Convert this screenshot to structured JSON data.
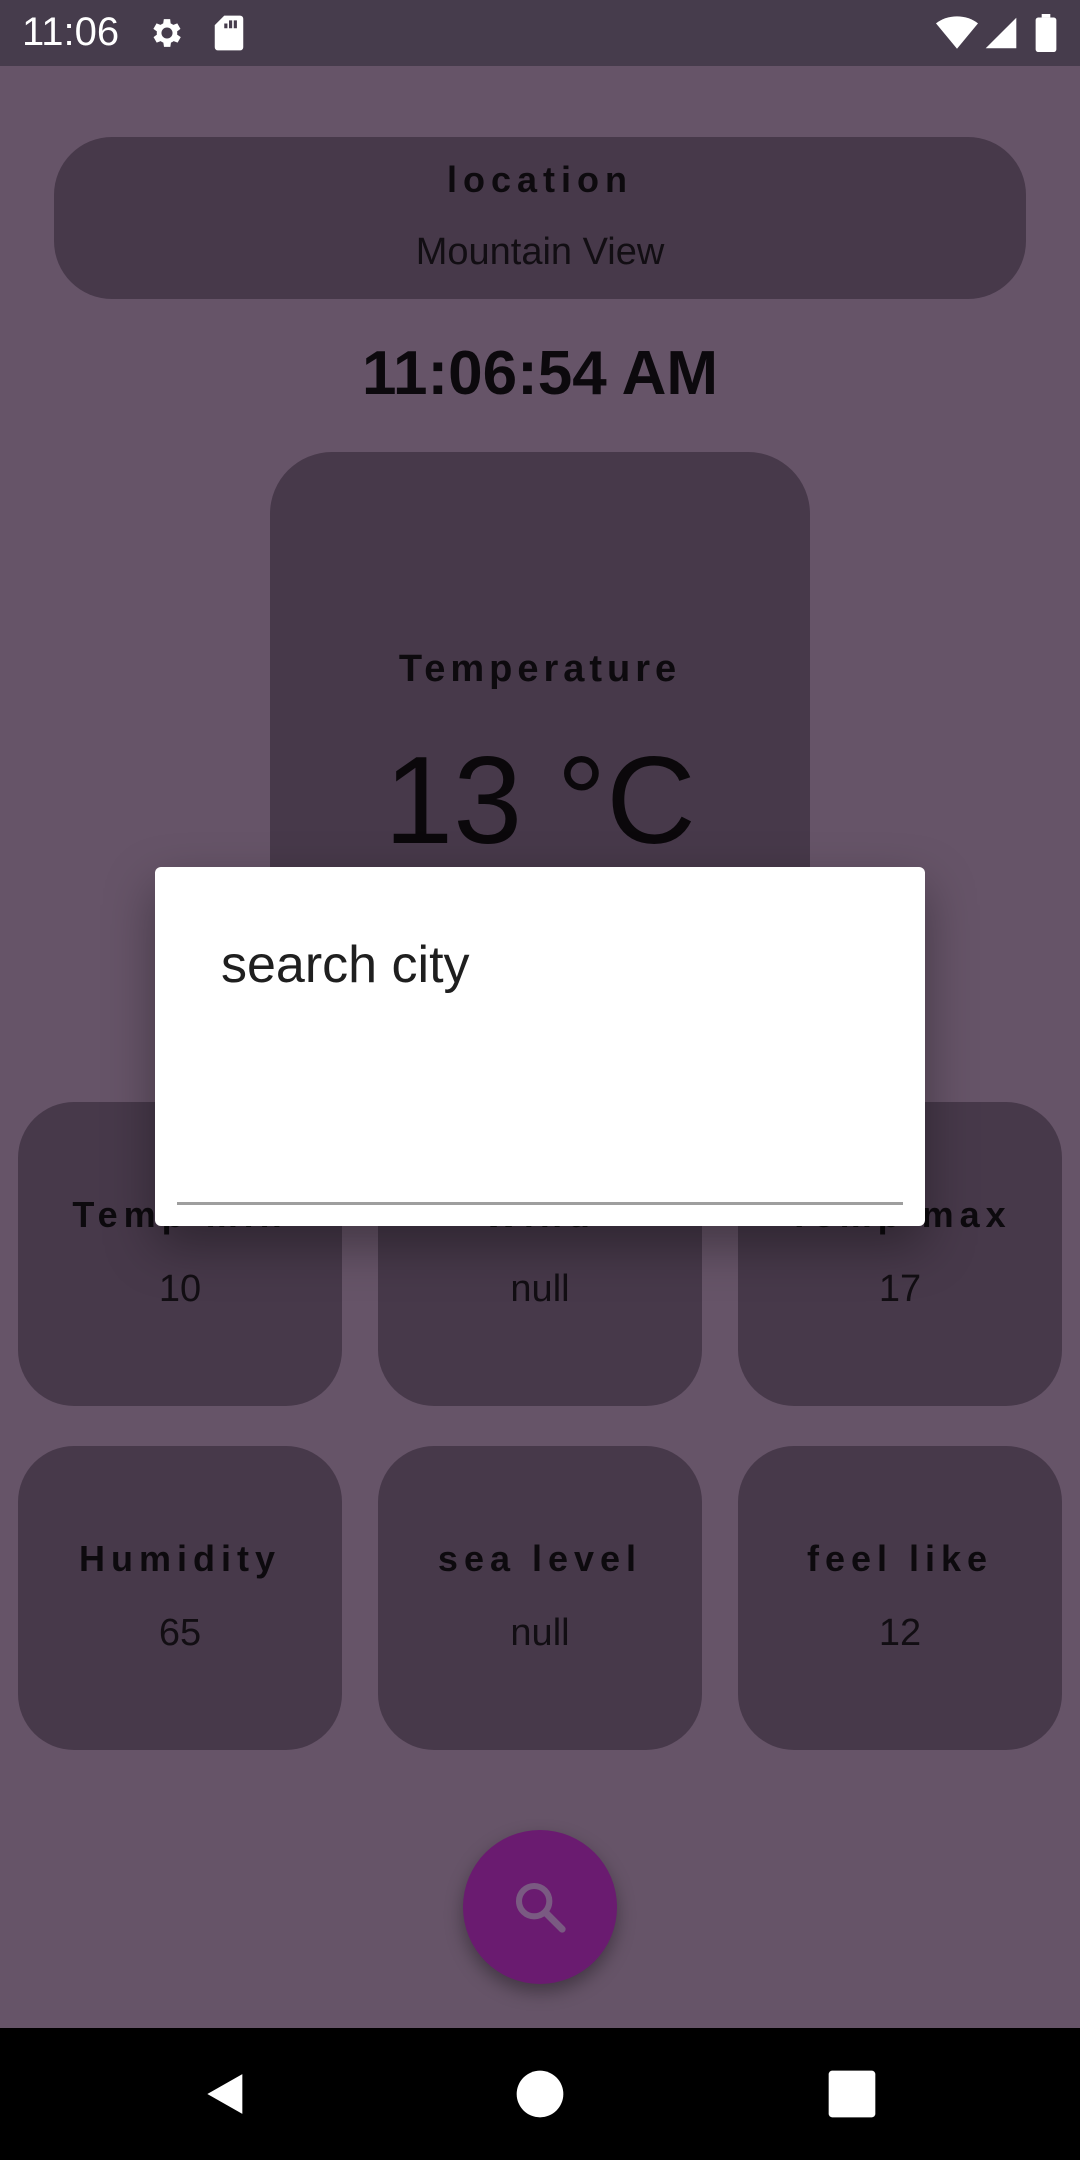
{
  "status_bar": {
    "time": "11:06",
    "icons": [
      "settings-icon",
      "sd-card-icon",
      "wifi-icon",
      "signal-icon",
      "battery-icon"
    ]
  },
  "location": {
    "label": "location",
    "value": "Mountain View"
  },
  "clock": "11:06:54 AM",
  "temperature": {
    "label": "Temperature",
    "value": "13 °C"
  },
  "stats": [
    {
      "label": "Temp min",
      "value": "10"
    },
    {
      "label": "Wind",
      "value": "null"
    },
    {
      "label": "Temp max",
      "value": "17"
    },
    {
      "label": "Humidity",
      "value": "65"
    },
    {
      "label": "sea level",
      "value": "null"
    },
    {
      "label": "feel like",
      "value": "12"
    }
  ],
  "fab": {
    "icon": "search-icon"
  },
  "dialog": {
    "title": "search city",
    "input_value": "",
    "input_placeholder": ""
  },
  "nav": {
    "icons": [
      "back-icon",
      "home-icon",
      "recents-icon"
    ]
  },
  "colors": {
    "status_bar": "#463c4c",
    "background": "#665468",
    "card": "#47394a",
    "fab": "#6a1b70",
    "dialog": "#ffffff"
  }
}
